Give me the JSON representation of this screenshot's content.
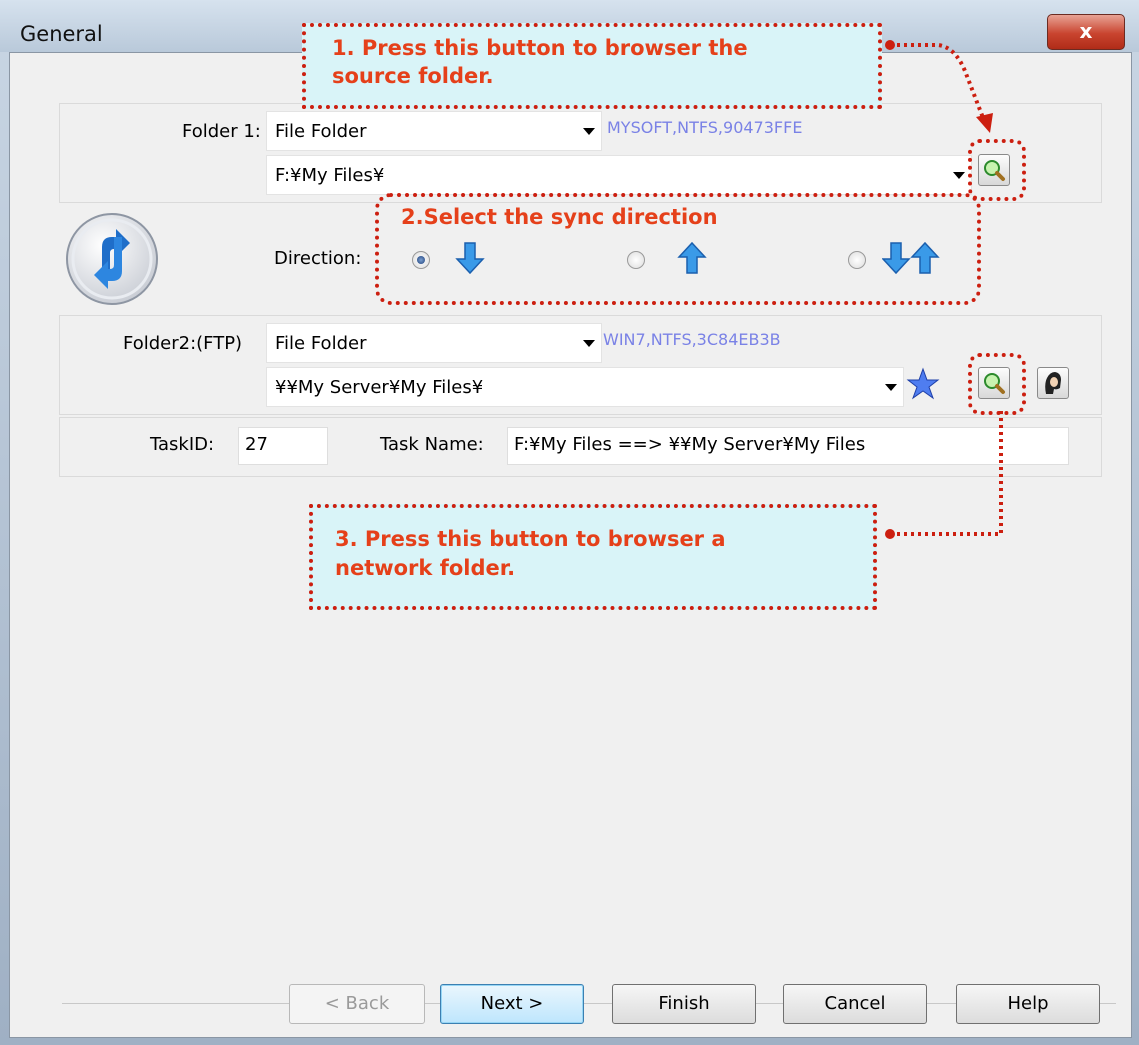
{
  "window": {
    "title": "General",
    "close_label": "x"
  },
  "folder1": {
    "label": "Folder 1:",
    "type_value": "File Folder",
    "volume_info": "MYSOFT,NTFS,90473FFE",
    "path_value": "F:¥My Files¥"
  },
  "direction": {
    "label": "Direction:",
    "options": [
      {
        "icon": "arrow-down-icon",
        "selected": true
      },
      {
        "icon": "arrow-up-icon",
        "selected": false
      },
      {
        "icon": "arrow-both-icon",
        "selected": false
      }
    ]
  },
  "folder2": {
    "label": "Folder2:(FTP)",
    "type_value": "File Folder",
    "volume_info": "WIN7,NTFS,3C84EB3B",
    "path_value": "¥¥My Server¥My Files¥"
  },
  "task": {
    "id_label": "TaskID:",
    "id_value": "27",
    "name_label": "Task Name:",
    "name_value": "F:¥My Files ==> ¥¥My Server¥My Files"
  },
  "callouts": {
    "c1_line1": "1. Press this button to browser the",
    "c1_line2": "source folder.",
    "c2": "2.Select the sync direction",
    "c3_line1": "3. Press this button to browser a",
    "c3_line2": "network folder."
  },
  "buttons": {
    "back": "< Back",
    "next": "Next >",
    "finish": "Finish",
    "cancel": "Cancel",
    "help": "Help"
  },
  "colors": {
    "callout_text": "#e5401a",
    "callout_border": "#cc1f10",
    "callout_bg": "#d9f4f8",
    "info_text": "#7a82e6"
  }
}
